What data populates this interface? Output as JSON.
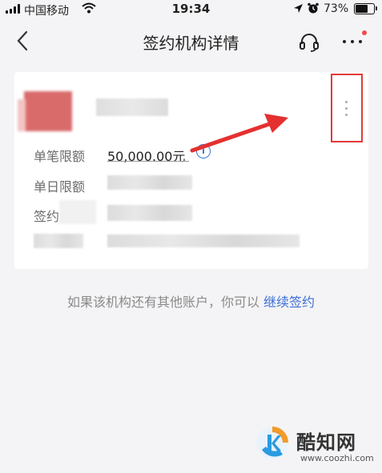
{
  "status_bar": {
    "carrier": "中国移动",
    "time": "19:34",
    "battery_percent": "73%",
    "battery_level": 0.73
  },
  "nav": {
    "title": "签约机构详情"
  },
  "card": {
    "rows": [
      {
        "label": "单笔限额",
        "value": "50,000.00元"
      },
      {
        "label": "单日限额",
        "value": ""
      },
      {
        "label": "签约",
        "value": ""
      }
    ]
  },
  "footer": {
    "prompt": "如果该机构还有其他账户，你可以",
    "link": "继续签约"
  },
  "watermark": {
    "name": "酷知网",
    "url": "www.coozhi.com"
  },
  "colors": {
    "accent_blue": "#3d6fd6",
    "highlight_red": "#e23a3a",
    "badge_red": "#f04a4a"
  }
}
